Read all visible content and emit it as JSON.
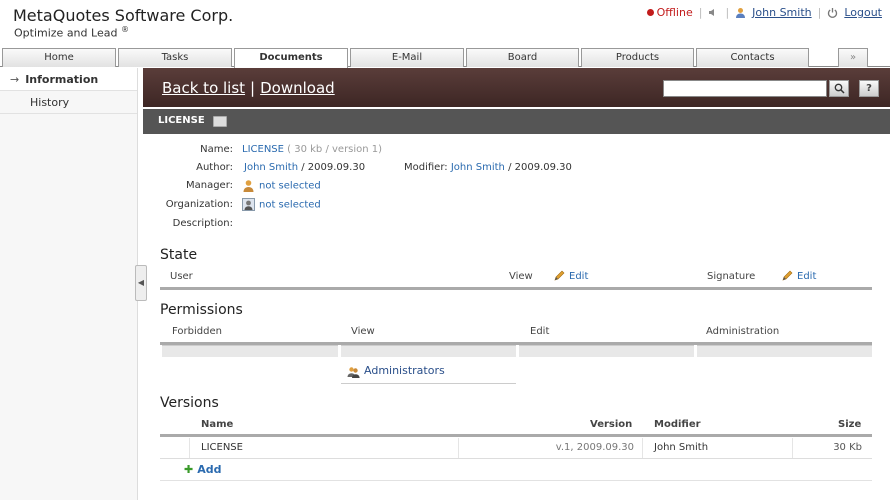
{
  "header": {
    "brand": "MetaQuotes Software Corp.",
    "tagline": "Optimize and Lead",
    "tagline_mark": "®",
    "status": "Offline",
    "user": "John Smith",
    "logout": "Logout"
  },
  "tabs": [
    {
      "label": "Home"
    },
    {
      "label": "Tasks"
    },
    {
      "label": "Documents"
    },
    {
      "label": "E-Mail"
    },
    {
      "label": "Board"
    },
    {
      "label": "Products"
    },
    {
      "label": "Contacts"
    },
    {
      "label": "»"
    }
  ],
  "sidebar": {
    "items": [
      {
        "label": "Information",
        "arrow": "→"
      },
      {
        "label": "History"
      }
    ]
  },
  "toolbar": {
    "back_label": "Back to list",
    "separator": "|",
    "download_label": "Download",
    "search_value": "",
    "help_label": "?"
  },
  "doc": {
    "title": "LICENSE",
    "name_label": "Name:",
    "name_value": "LICENSE",
    "name_meta": "( 30 kb / version 1)",
    "author_label": "Author:",
    "author_value": "John Smith",
    "author_date": "/ 2009.09.30",
    "modifier_label": "Modifier:",
    "modifier_value": "John Smith",
    "modifier_date": "/ 2009.09.30",
    "manager_label": "Manager:",
    "manager_value": "not selected",
    "org_label": "Organization:",
    "org_value": "not selected",
    "desc_label": "Description:"
  },
  "state": {
    "title": "State",
    "user_col": "User",
    "view_col": "View",
    "edit_label": "Edit",
    "signature_col": "Signature",
    "edit_label2": "Edit"
  },
  "permissions": {
    "title": "Permissions",
    "cols": [
      "Forbidden",
      "View",
      "Edit",
      "Administration"
    ],
    "view_entry": "Administrators"
  },
  "versions": {
    "title": "Versions",
    "cols": {
      "name": "Name",
      "version": "Version",
      "modifier": "Modifier",
      "size": "Size"
    },
    "rows": [
      {
        "name": "LICENSE",
        "version": "v.1, 2009.09.30",
        "modifier": "John Smith",
        "size": "30 Kb"
      }
    ],
    "add_label": "Add"
  },
  "colors": {
    "toolbar_bg": "#4a302d",
    "link": "#2a6aaf",
    "offline": "#c21b1b",
    "add_green": "#3a9a2a"
  }
}
